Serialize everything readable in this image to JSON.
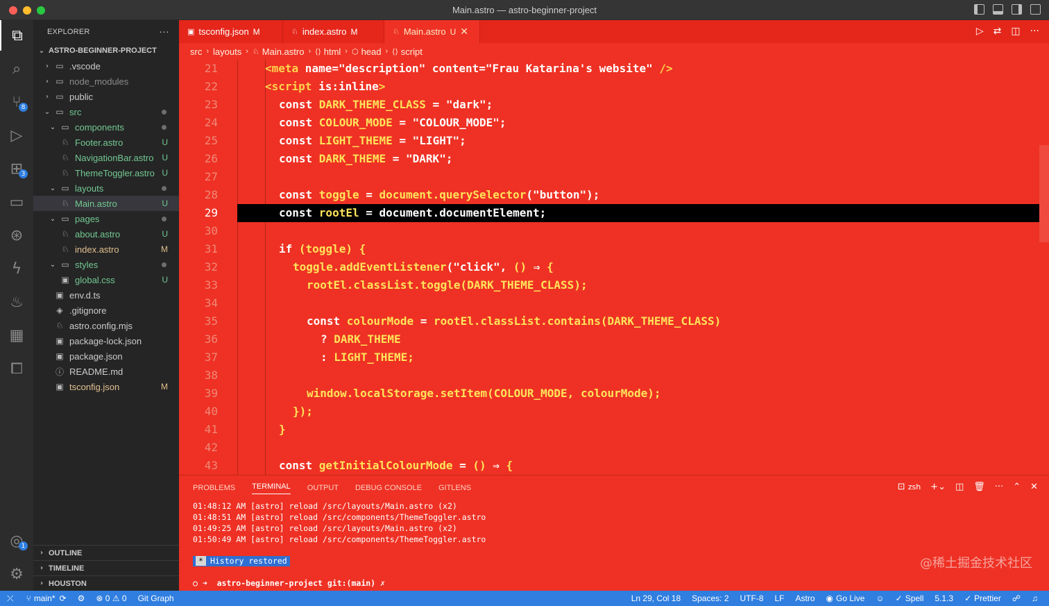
{
  "window": {
    "title": "Main.astro — astro-beginner-project"
  },
  "colors": {
    "editor_bg": "#ee3124",
    "status_bar": "#2f7ee0",
    "activity_bar": "#2c2c2c",
    "sidebar": "#252526"
  },
  "activity_bar": {
    "items": [
      {
        "icon": "files-icon",
        "badge": ""
      },
      {
        "icon": "search-icon",
        "badge": ""
      },
      {
        "icon": "source-control-icon",
        "badge": "8"
      },
      {
        "icon": "run-debug-icon",
        "badge": ""
      },
      {
        "icon": "extensions-icon",
        "badge": "3"
      },
      {
        "icon": "remote-explorer-icon",
        "badge": ""
      },
      {
        "icon": "git-graph-icon",
        "badge": ""
      },
      {
        "icon": "lightning-icon",
        "badge": ""
      },
      {
        "icon": "genie-icon",
        "badge": ""
      },
      {
        "icon": "docker-icon",
        "badge": ""
      },
      {
        "icon": "liveshare-icon",
        "badge": ""
      }
    ],
    "accounts_badge": "1"
  },
  "explorer": {
    "header": "EXPLORER",
    "more": "···",
    "project": "ASTRO-BEGINNER-PROJECT",
    "tree": [
      {
        "name": ".vscode",
        "type": "folder",
        "depth": 0,
        "open": false,
        "status": "",
        "dot": false
      },
      {
        "name": "node_modules",
        "type": "folder",
        "depth": 0,
        "open": false,
        "status": "",
        "dot": false,
        "dim": true
      },
      {
        "name": "public",
        "type": "folder",
        "depth": 0,
        "open": false,
        "status": "",
        "dot": false
      },
      {
        "name": "src",
        "type": "folder",
        "depth": 0,
        "open": true,
        "status": "",
        "dot": true,
        "green": true
      },
      {
        "name": "components",
        "type": "folder",
        "depth": 1,
        "open": true,
        "status": "",
        "dot": true,
        "green": true
      },
      {
        "name": "Footer.astro",
        "type": "astro",
        "depth": 2,
        "status": "U",
        "green": true
      },
      {
        "name": "NavigationBar.astro",
        "type": "astro",
        "depth": 2,
        "status": "U",
        "green": true
      },
      {
        "name": "ThemeToggler.astro",
        "type": "astro",
        "depth": 2,
        "status": "U",
        "green": true
      },
      {
        "name": "layouts",
        "type": "folder",
        "depth": 1,
        "open": true,
        "status": "",
        "dot": true,
        "green": true
      },
      {
        "name": "Main.astro",
        "type": "astro",
        "depth": 2,
        "status": "U",
        "green": true,
        "selected": true
      },
      {
        "name": "pages",
        "type": "folder",
        "depth": 1,
        "open": true,
        "status": "",
        "dot": true,
        "green": true
      },
      {
        "name": "about.astro",
        "type": "astro",
        "depth": 2,
        "status": "U",
        "green": true
      },
      {
        "name": "index.astro",
        "type": "astro",
        "depth": 2,
        "status": "M",
        "yellow": true
      },
      {
        "name": "styles",
        "type": "folder",
        "depth": 1,
        "open": true,
        "status": "",
        "dot": true,
        "green": true
      },
      {
        "name": "global.css",
        "type": "css",
        "depth": 2,
        "status": "U",
        "green": true
      },
      {
        "name": "env.d.ts",
        "type": "ts",
        "depth": 1,
        "status": ""
      },
      {
        "name": ".gitignore",
        "type": "git",
        "depth": 0,
        "status": ""
      },
      {
        "name": "astro.config.mjs",
        "type": "astro",
        "depth": 0,
        "status": ""
      },
      {
        "name": "package-lock.json",
        "type": "json",
        "depth": 0,
        "status": ""
      },
      {
        "name": "package.json",
        "type": "json",
        "depth": 0,
        "status": ""
      },
      {
        "name": "README.md",
        "type": "info",
        "depth": 0,
        "status": ""
      },
      {
        "name": "tsconfig.json",
        "type": "ts",
        "depth": 0,
        "status": "M",
        "yellow": true
      }
    ],
    "outline": "OUTLINE",
    "timeline": "TIMELINE",
    "houston": "HOUSTON"
  },
  "tabs": [
    {
      "label": "tsconfig.json",
      "mark": "M",
      "active": false
    },
    {
      "label": "index.astro",
      "mark": "M",
      "active": false
    },
    {
      "label": "Main.astro",
      "mark": "U",
      "active": true
    }
  ],
  "breadcrumb": [
    "src",
    "layouts",
    "Main.astro",
    "html",
    "head",
    "script"
  ],
  "code": {
    "current_line": 29,
    "lines": [
      {
        "n": "21",
        "indent": 2,
        "html": "<span class='tag'>&lt;meta</span> name=<span class='str'>\"description\"</span> content=<span class='str'>\"Frau Katarina's website\"</span> <span class='tag'>/&gt;</span>"
      },
      {
        "n": "22",
        "indent": 2,
        "html": "<span class='tag'>&lt;script</span> is:inline<span class='tag'>&gt;</span>"
      },
      {
        "n": "23",
        "indent": 3,
        "html": "const <span class='var'>DARK_THEME_CLASS</span> = \"dark\";"
      },
      {
        "n": "24",
        "indent": 3,
        "html": "const <span class='var'>COLOUR_MODE</span> = \"COLOUR_MODE\";"
      },
      {
        "n": "25",
        "indent": 3,
        "html": "const <span class='var'>LIGHT_THEME</span> = \"LIGHT\";"
      },
      {
        "n": "26",
        "indent": 3,
        "html": "const <span class='var'>DARK_THEME</span> = \"DARK\";"
      },
      {
        "n": "27",
        "indent": 3,
        "html": ""
      },
      {
        "n": "28",
        "indent": 3,
        "html": "const <span class='var'>toggle</span> = <span class='var'>document.querySelector</span>(\"button\");"
      },
      {
        "n": "29",
        "indent": 3,
        "html": "const <span class='var'>rootEl</span> = document.documentElement;"
      },
      {
        "n": "30",
        "indent": 3,
        "html": ""
      },
      {
        "n": "31",
        "indent": 3,
        "html": "if <span class='var'>(toggle)</span> <span class='var'>{</span>"
      },
      {
        "n": "32",
        "indent": 4,
        "html": "<span class='var'>toggle.addEventListener</span>(\"click\", <span class='var'>()</span> ⇒ <span class='var'>{</span>"
      },
      {
        "n": "33",
        "indent": 5,
        "html": "<span class='var'>rootEl.classList.toggle(DARK_THEME_CLASS);</span>"
      },
      {
        "n": "34",
        "indent": 5,
        "html": ""
      },
      {
        "n": "35",
        "indent": 5,
        "html": "const <span class='var'>colourMode</span> = <span class='var'>rootEl.classList.contains(DARK_THEME_CLASS)</span>"
      },
      {
        "n": "36",
        "indent": 6,
        "html": "? <span class='var'>DARK_THEME</span>"
      },
      {
        "n": "37",
        "indent": 6,
        "html": ": <span class='var'>LIGHT_THEME;</span>"
      },
      {
        "n": "38",
        "indent": 5,
        "html": ""
      },
      {
        "n": "39",
        "indent": 5,
        "html": "<span class='var'>window.localStorage.setItem(COLOUR_MODE, colourMode);</span>"
      },
      {
        "n": "40",
        "indent": 4,
        "html": "<span class='var'>});</span>"
      },
      {
        "n": "41",
        "indent": 3,
        "html": "<span class='var'>}</span>"
      },
      {
        "n": "42",
        "indent": 3,
        "html": ""
      },
      {
        "n": "43",
        "indent": 3,
        "html": "const <span class='var'>getInitialColourMode</span> = <span class='var'>()</span> ⇒ <span class='var'>{</span>"
      }
    ]
  },
  "panel": {
    "tabs": [
      "PROBLEMS",
      "TERMINAL",
      "OUTPUT",
      "DEBUG CONSOLE",
      "GITLENS"
    ],
    "active_tab": "TERMINAL",
    "shell": "zsh",
    "terminal_lines": [
      "01:48:12 AM [astro] reload /src/layouts/Main.astro (x2)",
      "01:48:51 AM [astro] reload /src/components/ThemeToggler.astro",
      "01:49:25 AM [astro] reload /src/layouts/Main.astro (x2)",
      "01:50:49 AM [astro] reload /src/components/ThemeToggler.astro"
    ],
    "history_star": "*",
    "history_label": "History restored",
    "prompt": "○ ➜  astro-beginner-project git:(main) ✗"
  },
  "watermark": "@稀土掘金技术社区",
  "statusbar": {
    "branch": "main*",
    "errors": "0",
    "warnings": "0",
    "git_graph": "Git Graph",
    "position": "Ln 29, Col 18",
    "spaces": "Spaces: 2",
    "encoding": "UTF-8",
    "eol": "LF",
    "language": "Astro",
    "go_live": "Go Live",
    "spell": "Spell",
    "version": "5.1.3",
    "prettier": "Prettier"
  }
}
